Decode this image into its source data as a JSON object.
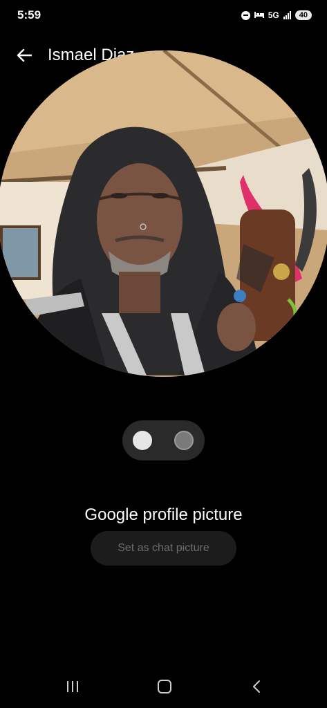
{
  "status_bar": {
    "time": "5:59",
    "network": "5G",
    "battery": "40",
    "icons": [
      "do-not-disturb-icon",
      "bed-icon",
      "signal-icon",
      "battery-icon"
    ]
  },
  "header": {
    "title": "Ismael Diaz",
    "back_icon": "arrow-left-icon"
  },
  "pager": {
    "count": 2,
    "active_index": 0
  },
  "picture": {
    "label": "Google profile picture"
  },
  "actions": {
    "set_chat_picture": "Set as chat picture"
  },
  "nav_bar": {
    "icons": [
      "recents-icon",
      "home-icon",
      "back-icon"
    ]
  }
}
